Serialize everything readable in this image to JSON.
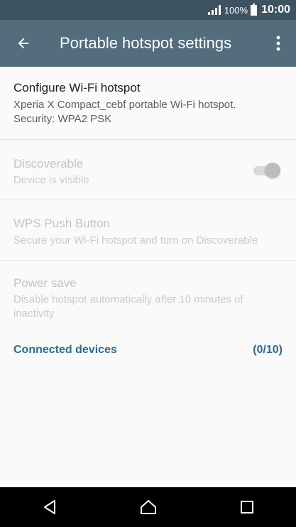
{
  "status_bar": {
    "battery_percent": "100%",
    "time": "10:00"
  },
  "app_bar": {
    "title": "Portable hotspot settings",
    "back_icon": "arrow-back-icon",
    "more_icon": "more-vert-icon"
  },
  "settings": {
    "configure": {
      "title": "Configure Wi-Fi hotspot",
      "summary_line1": "Xperia X Compact_cebf portable Wi-Fi hotspot.",
      "summary_line2": "Security: WPA2 PSK"
    },
    "discoverable": {
      "title": "Discoverable",
      "summary": "Device is visible",
      "enabled": false,
      "checked": true
    },
    "wps": {
      "title": "WPS Push Button",
      "summary": "Secure your Wi-Fi hotspot and turn on Discoverable"
    },
    "power_save": {
      "title": "Power save",
      "summary": "Disable hotspot automatically after 10 minutes of inactivity"
    }
  },
  "connected_devices": {
    "label": "Connected devices",
    "count": "(0/10)"
  },
  "colors": {
    "status_bar": "#3d5361",
    "app_bar": "#536d7d",
    "accent": "#2e6b8f"
  },
  "nav_bar": {
    "back_icon": "triangle-back-icon",
    "home_icon": "home-icon",
    "recents_icon": "square-recents-icon"
  }
}
